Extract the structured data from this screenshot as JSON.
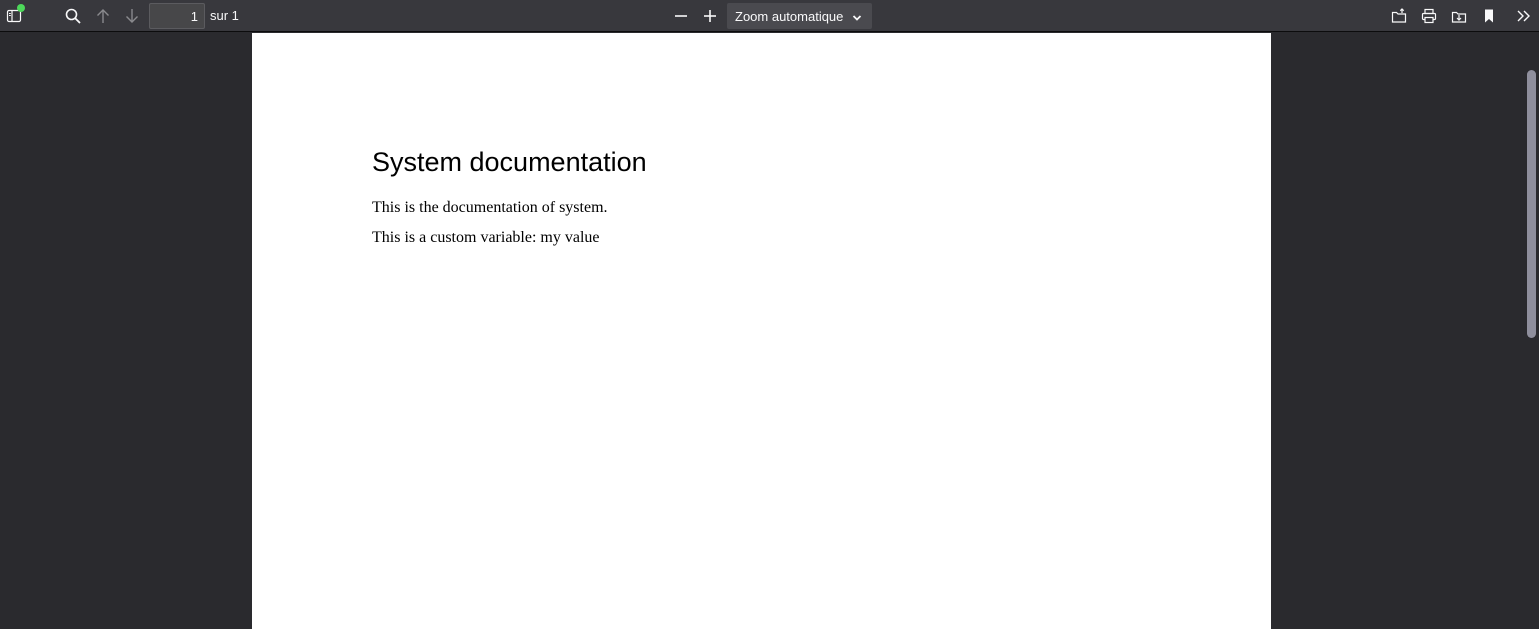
{
  "toolbar": {
    "page_number": "1",
    "page_count_label": "sur 1",
    "zoom_label": "Zoom automatique",
    "icons": {
      "sidebar": "sidebar-toggle-icon",
      "find": "search-icon",
      "previous": "arrow-up-icon",
      "next": "arrow-down-icon",
      "zoom_out": "minus-icon",
      "zoom_in": "plus-icon",
      "open": "open-file-icon",
      "print": "print-icon",
      "download": "download-icon",
      "bookmark": "bookmark-icon",
      "tools": "double-chevron-right-icon"
    },
    "notification_color": "#4dd85a"
  },
  "document": {
    "title": "System documentation",
    "paragraphs": [
      "This is the documentation of system.",
      "This is a custom variable: my value"
    ]
  }
}
